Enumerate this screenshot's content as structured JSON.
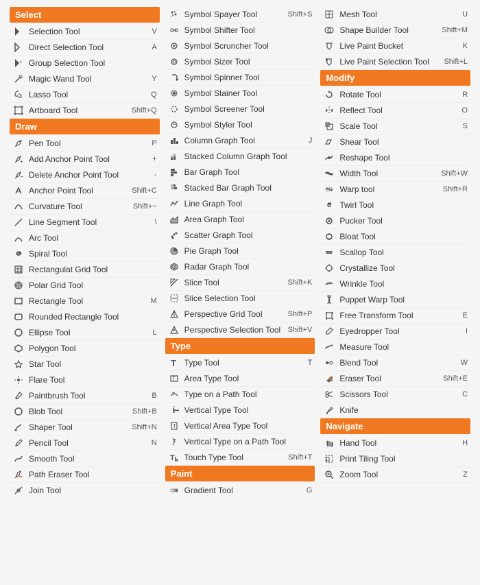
{
  "columns": [
    {
      "sections": [
        {
          "header": "Select",
          "tools": [
            {
              "name": "Selection Tool",
              "shortcut": "V",
              "icon": "arrow"
            },
            {
              "name": "Direct Selection Tool",
              "shortcut": "A",
              "icon": "arrow-hollow"
            },
            {
              "name": "Group Selection Tool",
              "shortcut": "",
              "icon": "arrow-plus"
            },
            {
              "name": "Magic Wand Tool",
              "shortcut": "Y",
              "icon": "wand"
            },
            {
              "name": "Lasso Tool",
              "shortcut": "Q",
              "icon": "lasso"
            },
            {
              "name": "Artboard Tool",
              "shortcut": "Shift+Q",
              "icon": "artboard"
            }
          ]
        },
        {
          "header": "Draw",
          "tools": [
            {
              "name": "Pen Tool",
              "shortcut": "P",
              "icon": "pen"
            },
            {
              "name": "Add Anchor Point Tool",
              "shortcut": "+",
              "icon": "pen-plus"
            },
            {
              "name": "Delete Anchor Point Tool",
              "shortcut": "-",
              "icon": "pen-minus"
            },
            {
              "name": "Anchor Point Tool",
              "shortcut": "Shift+C",
              "icon": "anchor"
            },
            {
              "name": "Curvature Tool",
              "shortcut": "Shift+~",
              "icon": "curve"
            },
            {
              "name": "Line Segment Tool",
              "shortcut": "\\",
              "icon": "line"
            },
            {
              "name": "Arc Tool",
              "shortcut": "",
              "icon": "arc"
            },
            {
              "name": "Spiral Tool",
              "shortcut": "",
              "icon": "spiral"
            },
            {
              "name": "Rectangulat Grid Tool",
              "shortcut": "",
              "icon": "grid-rect"
            },
            {
              "name": "Polar Grid Tool",
              "shortcut": "",
              "icon": "grid-polar"
            },
            {
              "name": "Rectangle Tool",
              "shortcut": "M",
              "icon": "rectangle"
            },
            {
              "name": "Rounded Rectangle Tool",
              "shortcut": "",
              "icon": "rounded-rect"
            },
            {
              "name": "Ellipse Tool",
              "shortcut": "L",
              "icon": "ellipse"
            },
            {
              "name": "Polygon Tool",
              "shortcut": "",
              "icon": "polygon"
            },
            {
              "name": "Star Tool",
              "shortcut": "",
              "icon": "star"
            },
            {
              "name": "Flare Tool",
              "shortcut": "",
              "icon": "flare"
            },
            {
              "name": "Paintbrush Tool",
              "shortcut": "B",
              "icon": "paintbrush"
            },
            {
              "name": "Blob Tool",
              "shortcut": "Shift+B",
              "icon": "blob"
            },
            {
              "name": "Shaper Tool",
              "shortcut": "Shift+N",
              "icon": "shaper"
            },
            {
              "name": "Pencil Tool",
              "shortcut": "N",
              "icon": "pencil"
            },
            {
              "name": "Smooth Tool",
              "shortcut": "",
              "icon": "smooth"
            },
            {
              "name": "Path Eraser Tool",
              "shortcut": "",
              "icon": "path-eraser"
            },
            {
              "name": "Join Tool",
              "shortcut": "",
              "icon": "join"
            }
          ]
        }
      ]
    },
    {
      "sections": [
        {
          "header": "",
          "tools": [
            {
              "name": "Symbol Spayer Tool",
              "shortcut": "Shift+S",
              "icon": "sym-spray"
            },
            {
              "name": "Symbol Shifter Tool",
              "shortcut": "",
              "icon": "sym-shift"
            },
            {
              "name": "Symbol Scruncher Tool",
              "shortcut": "",
              "icon": "sym-scrunch"
            },
            {
              "name": "Symbol Sizer Tool",
              "shortcut": "",
              "icon": "sym-size"
            },
            {
              "name": "Symbol Spinner Tool",
              "shortcut": "",
              "icon": "sym-spin"
            },
            {
              "name": "Symbol Stainer Tool",
              "shortcut": "",
              "icon": "sym-stain"
            },
            {
              "name": "Symbol Screener Tool",
              "shortcut": "",
              "icon": "sym-screen"
            },
            {
              "name": "Symbol Styler Tool",
              "shortcut": "",
              "icon": "sym-style"
            },
            {
              "name": "Column Graph Tool",
              "shortcut": "J",
              "icon": "col-graph"
            },
            {
              "name": "Stacked Column Graph Tool",
              "shortcut": "",
              "icon": "stacked-col"
            },
            {
              "name": "Bar Graph Tool",
              "shortcut": "",
              "icon": "bar-graph"
            },
            {
              "name": "Stacked Bar Graph Tool",
              "shortcut": "",
              "icon": "stacked-bar"
            },
            {
              "name": "Line Graph Tool",
              "shortcut": "",
              "icon": "line-graph"
            },
            {
              "name": "Area Graph Tool",
              "shortcut": "",
              "icon": "area-graph"
            },
            {
              "name": "Scatter Graph Tool",
              "shortcut": "",
              "icon": "scatter-graph"
            },
            {
              "name": "Pie Graph Tool",
              "shortcut": "",
              "icon": "pie-graph"
            },
            {
              "name": "Radar Graph Tool",
              "shortcut": "",
              "icon": "radar-graph"
            },
            {
              "name": "Slice Tool",
              "shortcut": "Shift+K",
              "icon": "slice"
            },
            {
              "name": "Slice Selection Tool",
              "shortcut": "",
              "icon": "slice-sel"
            },
            {
              "name": "Perspective Grid Tool",
              "shortcut": "Shift+P",
              "icon": "persp-grid"
            },
            {
              "name": "Perspective Selection Tool",
              "shortcut": "Shift+V",
              "icon": "persp-sel"
            }
          ]
        },
        {
          "header": "Type",
          "tools": [
            {
              "name": "Type Tool",
              "shortcut": "T",
              "icon": "type-t"
            },
            {
              "name": "Area Type Tool",
              "shortcut": "",
              "icon": "area-type"
            },
            {
              "name": "Type on a Path Tool",
              "shortcut": "",
              "icon": "path-type"
            },
            {
              "name": "Vertical Type Tool",
              "shortcut": "",
              "icon": "vert-type"
            },
            {
              "name": "Vertical Area Type Tool",
              "shortcut": "",
              "icon": "vert-area-type"
            },
            {
              "name": "Vertical Type on a Path Tool",
              "shortcut": "",
              "icon": "vert-path-type"
            },
            {
              "name": "Touch Type Tool",
              "shortcut": "Shift+T",
              "icon": "touch-type"
            }
          ]
        },
        {
          "header": "Paint",
          "tools": [
            {
              "name": "Gradient Tool",
              "shortcut": "G",
              "icon": "gradient"
            }
          ]
        }
      ]
    },
    {
      "sections": [
        {
          "header": "",
          "tools": [
            {
              "name": "Mesh Tool",
              "shortcut": "U",
              "icon": "mesh"
            },
            {
              "name": "Shape Builder Tool",
              "shortcut": "Shift+M",
              "icon": "shape-builder"
            },
            {
              "name": "Live Paint Bucket",
              "shortcut": "K",
              "icon": "paint-bucket"
            },
            {
              "name": "Live Paint Selection Tool",
              "shortcut": "Shift+L",
              "icon": "paint-sel"
            }
          ]
        },
        {
          "header": "Modify",
          "tools": [
            {
              "name": "Rotate Tool",
              "shortcut": "R",
              "icon": "rotate"
            },
            {
              "name": "Reflect Tool",
              "shortcut": "O",
              "icon": "reflect"
            },
            {
              "name": "Scale Tool",
              "shortcut": "S",
              "icon": "scale"
            },
            {
              "name": "Shear Tool",
              "shortcut": "",
              "icon": "shear"
            },
            {
              "name": "Reshape Tool",
              "shortcut": "",
              "icon": "reshape"
            },
            {
              "name": "Width Tool",
              "shortcut": "Shift+W",
              "icon": "width"
            },
            {
              "name": "Warp tool",
              "shortcut": "Shift+R",
              "icon": "warp"
            },
            {
              "name": "Twirl Tool",
              "shortcut": "",
              "icon": "twirl"
            },
            {
              "name": "Pucker Tool",
              "shortcut": "",
              "icon": "pucker"
            },
            {
              "name": "Bloat Tool",
              "shortcut": "",
              "icon": "bloat"
            },
            {
              "name": "Scallop Tool",
              "shortcut": "",
              "icon": "scallop"
            },
            {
              "name": "Crystallize Tool",
              "shortcut": "",
              "icon": "crystallize"
            },
            {
              "name": "Wrinkle Tool",
              "shortcut": "",
              "icon": "wrinkle"
            },
            {
              "name": "Puppet Warp Tool",
              "shortcut": "",
              "icon": "puppet-warp"
            },
            {
              "name": "Free Transform Tool",
              "shortcut": "E",
              "icon": "free-transform"
            },
            {
              "name": "Eyedropper Tool",
              "shortcut": "I",
              "icon": "eyedropper"
            },
            {
              "name": "Measure Tool",
              "shortcut": "",
              "icon": "measure"
            },
            {
              "name": "Blend Tool",
              "shortcut": "W",
              "icon": "blend"
            },
            {
              "name": "Eraser Tool",
              "shortcut": "Shift+E",
              "icon": "eraser"
            },
            {
              "name": "Scissors Tool",
              "shortcut": "C",
              "icon": "scissors"
            },
            {
              "name": "Knife",
              "shortcut": "",
              "icon": "knife"
            }
          ]
        },
        {
          "header": "Navigate",
          "tools": [
            {
              "name": "Hand Tool",
              "shortcut": "H",
              "icon": "hand"
            },
            {
              "name": "Print Tiling Tool",
              "shortcut": "",
              "icon": "print-tiling"
            },
            {
              "name": "Zoom Tool",
              "shortcut": "Z",
              "icon": "zoom"
            }
          ]
        }
      ]
    }
  ],
  "icons": {
    "arrow": "▷",
    "arrow-hollow": "◁",
    "arrow-plus": "▶",
    "wand": "✦",
    "lasso": "⌾",
    "artboard": "⬜",
    "pen": "✒",
    "pen-plus": "✒",
    "pen-minus": "✒",
    "anchor": "◆",
    "curve": "〜",
    "line": "╱",
    "arc": "⌒",
    "spiral": "🌀",
    "grid-rect": "⊞",
    "grid-polar": "◎",
    "rectangle": "▭",
    "rounded-rect": "▢",
    "ellipse": "◯",
    "polygon": "⬡",
    "star": "★",
    "flare": "✳",
    "paintbrush": "🖌",
    "blob": "⬤",
    "shaper": "✐",
    "pencil": "✏",
    "smooth": "〰",
    "path-eraser": "⌫",
    "join": "⊕",
    "sym-spray": "⋆",
    "sym-shift": "⟿",
    "sym-scrunch": "◉",
    "sym-size": "◎",
    "sym-spin": "↺",
    "sym-stain": "◈",
    "sym-screen": "◻",
    "sym-style": "◈",
    "col-graph": "▋",
    "stacked-col": "▊",
    "bar-graph": "▬",
    "stacked-bar": "▬",
    "line-graph": "📈",
    "area-graph": "📊",
    "scatter-graph": "⠿",
    "pie-graph": "◑",
    "radar-graph": "⬡",
    "slice": "✂",
    "slice-sel": "✂",
    "persp-grid": "⊡",
    "persp-sel": "⊡",
    "type-t": "T",
    "area-type": "T",
    "path-type": "T",
    "vert-type": "T",
    "vert-area-type": "T",
    "vert-path-type": "T",
    "touch-type": "T",
    "gradient": "◫",
    "mesh": "⊞",
    "shape-builder": "⬠",
    "paint-bucket": "⬤",
    "paint-sel": "⬤",
    "rotate": "↻",
    "reflect": "⇔",
    "scale": "⤡",
    "shear": "⊿",
    "reshape": "◈",
    "width": "⟺",
    "warp": "〰",
    "twirl": "↺",
    "pucker": "◎",
    "bloat": "●",
    "scallop": "〜",
    "crystallize": "✳",
    "wrinkle": "〰",
    "puppet-warp": "⟡",
    "free-transform": "⬚",
    "eyedropper": "🖊",
    "measure": "📏",
    "blend": "⬟",
    "eraser": "⬛",
    "scissors": "✂",
    "knife": "🗡",
    "hand": "✋",
    "print-tiling": "⊡",
    "zoom": "🔍"
  }
}
